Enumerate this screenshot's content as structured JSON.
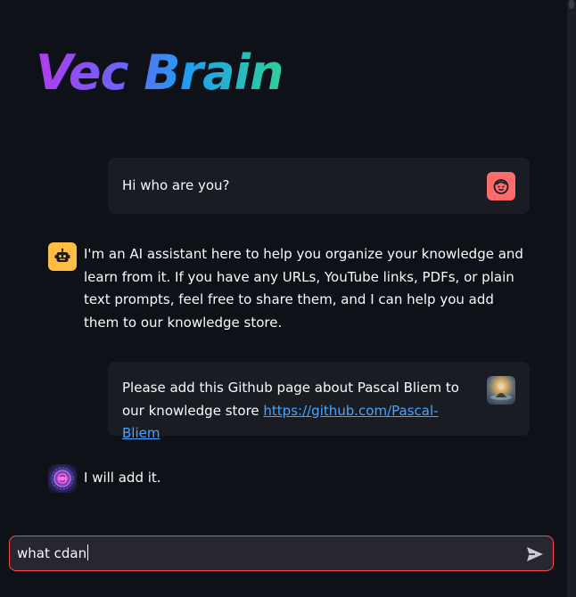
{
  "app": {
    "title": "Vec Brain"
  },
  "messages": [
    {
      "role": "user",
      "avatar": "smiley-face-icon",
      "text": "Hi who are you?"
    },
    {
      "role": "assistant",
      "avatar": "robot-icon",
      "text": "I'm an AI assistant here to help you organize your knowledge and learn from it. If you have any URLs, YouTube links, PDFs, or plain text prompts, feel free to share them, and I can help you add them to our knowledge store."
    },
    {
      "role": "user",
      "avatar": "user-photo-avatar",
      "text": "Please add this Github page about Pascal Bliem to our knowledge store ",
      "link": "https://github.com/Pascal-Bliem"
    },
    {
      "role": "assistant",
      "avatar": "brain-avatar",
      "text": "I will add it."
    }
  ],
  "chat_input": {
    "value": "what cdan",
    "send_icon": "send-icon"
  },
  "colors": {
    "background": "#0e1117",
    "user_bubble": "#1a1c24",
    "input_border": "#ff4b4b",
    "link": "#4aa3ff",
    "user_avatar": "#ff6b6b",
    "bot_avatar": "#ffbd45"
  }
}
